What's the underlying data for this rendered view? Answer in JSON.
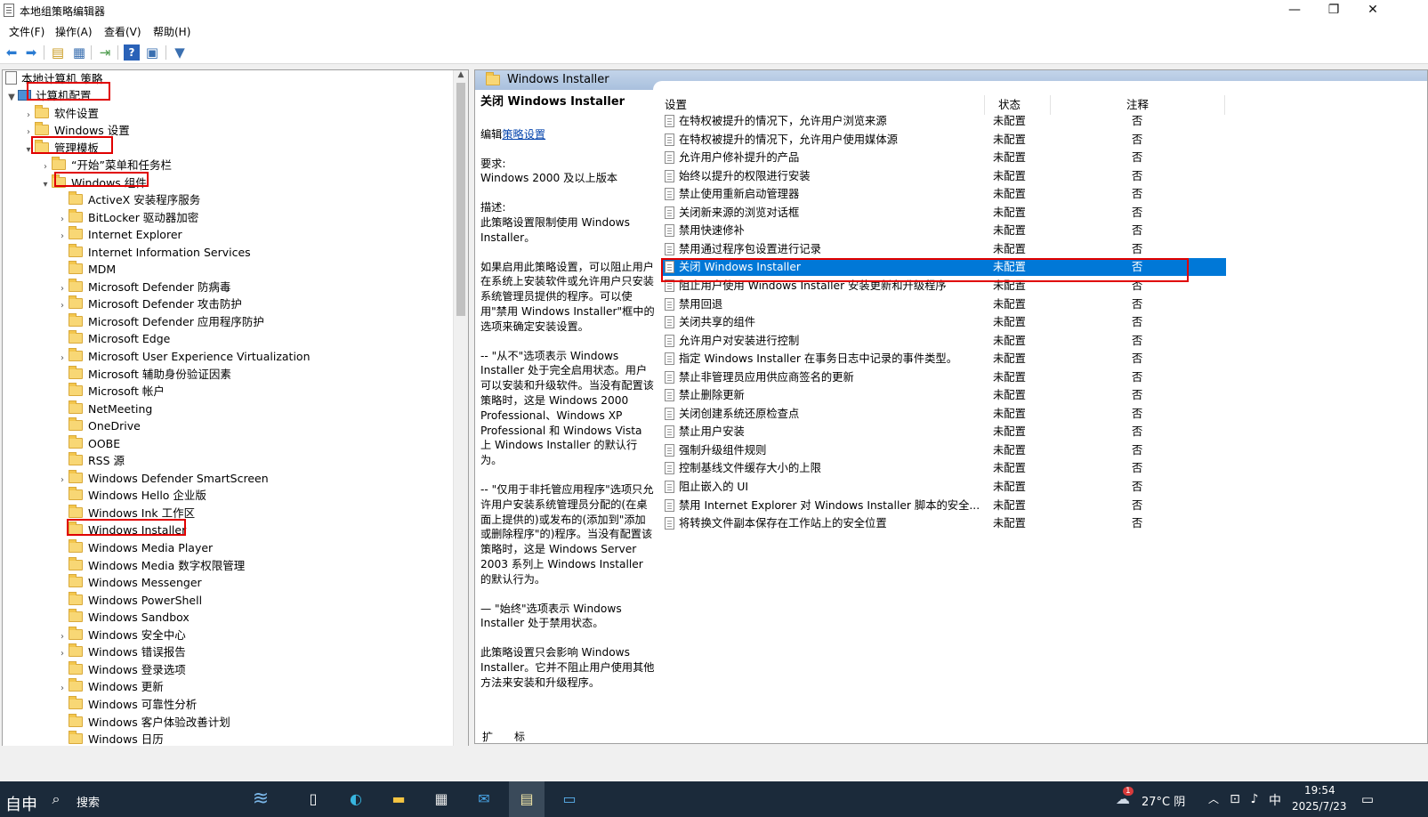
{
  "window": {
    "title": "本地组策略编辑器",
    "controls": {
      "minimize": "—",
      "maximize": "❐",
      "close": "✕"
    }
  },
  "menu": [
    "文件(F)",
    "操作(A)",
    "查看(V)",
    "帮助(H)"
  ],
  "toolbar": {
    "icons": [
      "back-icon",
      "forward-icon",
      "up-folder-icon",
      "show-hide-tree-icon",
      "export-list-icon",
      "help-icon",
      "properties-icon",
      "filter-icon"
    ]
  },
  "tree": {
    "root": "本地计算机 策略",
    "computer_config": "计算机配置",
    "software_settings": "软件设置",
    "windows_settings": "Windows 设置",
    "admin_templates": "管理模板",
    "start_menu": "“开始”菜单和任务栏",
    "windows_components": "Windows 组件",
    "items": [
      {
        "label": "ActiveX 安装程序服务",
        "expandable": false
      },
      {
        "label": "BitLocker 驱动器加密",
        "expandable": true
      },
      {
        "label": "Internet Explorer",
        "expandable": true
      },
      {
        "label": "Internet Information Services",
        "expandable": false
      },
      {
        "label": "MDM",
        "expandable": false
      },
      {
        "label": "Microsoft Defender 防病毒",
        "expandable": true
      },
      {
        "label": "Microsoft Defender 攻击防护",
        "expandable": true
      },
      {
        "label": "Microsoft Defender 应用程序防护",
        "expandable": false
      },
      {
        "label": "Microsoft Edge",
        "expandable": false
      },
      {
        "label": "Microsoft User Experience Virtualization",
        "expandable": true
      },
      {
        "label": "Microsoft 辅助身份验证因素",
        "expandable": false
      },
      {
        "label": "Microsoft 帐户",
        "expandable": false
      },
      {
        "label": "NetMeeting",
        "expandable": false
      },
      {
        "label": "OneDrive",
        "expandable": false
      },
      {
        "label": "OOBE",
        "expandable": false
      },
      {
        "label": "RSS 源",
        "expandable": false
      },
      {
        "label": "Windows Defender SmartScreen",
        "expandable": true
      },
      {
        "label": "Windows Hello 企业版",
        "expandable": false
      },
      {
        "label": "Windows Ink 工作区",
        "expandable": false
      },
      {
        "label": "Windows Installer",
        "expandable": false,
        "selected": true
      },
      {
        "label": "Windows Media Player",
        "expandable": false
      },
      {
        "label": "Windows Media 数字权限管理",
        "expandable": false
      },
      {
        "label": "Windows Messenger",
        "expandable": false
      },
      {
        "label": "Windows PowerShell",
        "expandable": false
      },
      {
        "label": "Windows Sandbox",
        "expandable": false
      },
      {
        "label": "Windows 安全中心",
        "expandable": true
      },
      {
        "label": "Windows 错误报告",
        "expandable": true
      },
      {
        "label": "Windows 登录选项",
        "expandable": false
      },
      {
        "label": "Windows 更新",
        "expandable": true
      },
      {
        "label": "Windows 可靠性分析",
        "expandable": false
      },
      {
        "label": "Windows 客户体验改善计划",
        "expandable": false
      },
      {
        "label": "Windows 日历",
        "expandable": false
      }
    ]
  },
  "detail": {
    "header_title": "Windows Installer",
    "policy_title": "关闭 Windows Installer",
    "edit_prefix": "编辑",
    "edit_link": "策略设置",
    "requirements_label": "要求:",
    "requirements": "Windows 2000 及以上版本",
    "description_label": "描述:",
    "paragraphs": [
      "此策略设置限制使用 Windows Installer。",
      "如果启用此策略设置，可以阻止用户在系统上安装软件或允许用户只安装系统管理员提供的程序。可以使用\"禁用 Windows Installer\"框中的选项来确定安装设置。",
      "-- \"从不\"选项表示 Windows Installer 处于完全启用状态。用户可以安装和升级软件。当没有配置该策略时，这是 Windows 2000 Professional、Windows XP Professional 和 Windows Vista 上 Windows Installer 的默认行为。",
      "-- \"仅用于非托管应用程序\"选项只允许用户安装系统管理员分配的(在桌面上提供的)或发布的(添加到\"添加或删除程序\"的)程序。当没有配置该策略时，这是 Windows Server 2003 系列上 Windows Installer 的默认行为。",
      "— \"始终\"选项表示 Windows Installer 处于禁用状态。",
      "此策略设置只会影响 Windows Installer。它并不阻止用户使用其他方法来安装和升级程序。"
    ]
  },
  "columns": {
    "setting": "设置",
    "state": "状态",
    "comment": "注释"
  },
  "policies": [
    {
      "name": "在特权被提升的情况下，允许用户浏览来源",
      "state": "未配置",
      "comment": "否"
    },
    {
      "name": "在特权被提升的情况下，允许用户使用媒体源",
      "state": "未配置",
      "comment": "否"
    },
    {
      "name": "允许用户修补提升的产品",
      "state": "未配置",
      "comment": "否"
    },
    {
      "name": "始终以提升的权限进行安装",
      "state": "未配置",
      "comment": "否"
    },
    {
      "name": "禁止使用重新启动管理器",
      "state": "未配置",
      "comment": "否"
    },
    {
      "name": "关闭新来源的浏览对话框",
      "state": "未配置",
      "comment": "否"
    },
    {
      "name": "禁用快速修补",
      "state": "未配置",
      "comment": "否"
    },
    {
      "name": "禁用通过程序包设置进行记录",
      "state": "未配置",
      "comment": "否"
    },
    {
      "name": "关闭 Windows Installer",
      "state": "未配置",
      "comment": "否",
      "selected": true
    },
    {
      "name": "阻止用户使用 Windows Installer 安装更新和升级程序",
      "state": "未配置",
      "comment": "否"
    },
    {
      "name": "禁用回退",
      "state": "未配置",
      "comment": "否"
    },
    {
      "name": "关闭共享的组件",
      "state": "未配置",
      "comment": "否"
    },
    {
      "name": "允许用户对安装进行控制",
      "state": "未配置",
      "comment": "否"
    },
    {
      "name": "指定 Windows Installer 在事务日志中记录的事件类型。",
      "state": "未配置",
      "comment": "否"
    },
    {
      "name": "禁止非管理员应用供应商签名的更新",
      "state": "未配置",
      "comment": "否"
    },
    {
      "name": "禁止删除更新",
      "state": "未配置",
      "comment": "否"
    },
    {
      "name": "关闭创建系统还原检查点",
      "state": "未配置",
      "comment": "否"
    },
    {
      "name": "禁止用户安装",
      "state": "未配置",
      "comment": "否"
    },
    {
      "name": "强制升级组件规则",
      "state": "未配置",
      "comment": "否"
    },
    {
      "name": "控制基线文件缓存大小的上限",
      "state": "未配置",
      "comment": "否"
    },
    {
      "name": "阻止嵌入的 UI",
      "state": "未配置",
      "comment": "否"
    },
    {
      "name": "禁用 Internet Explorer 对 Windows Installer 脚本的安全...",
      "state": "未配置",
      "comment": "否"
    },
    {
      "name": "将转换文件副本保存在工作站上的安全位置",
      "state": "未配置",
      "comment": "否"
    }
  ],
  "tabs": {
    "extended": "扩展",
    "standard": "标准"
  },
  "taskbar": {
    "ime_start": "自申",
    "search": "搜索",
    "weather": "27°C 阴",
    "weather_badge": "1",
    "ime": "中",
    "time": "19:54",
    "date": "2025/7/23",
    "apps": [
      "task-view-icon",
      "edge-icon",
      "file-explorer-icon",
      "store-icon",
      "mail-icon",
      "notepad-icon",
      "policy-editor-icon"
    ]
  },
  "colors": {
    "selection": "#0078d7",
    "highlight_box": "#e00000",
    "header_gradient": "#a9c0dd",
    "taskbar": "#1b2a3a"
  }
}
